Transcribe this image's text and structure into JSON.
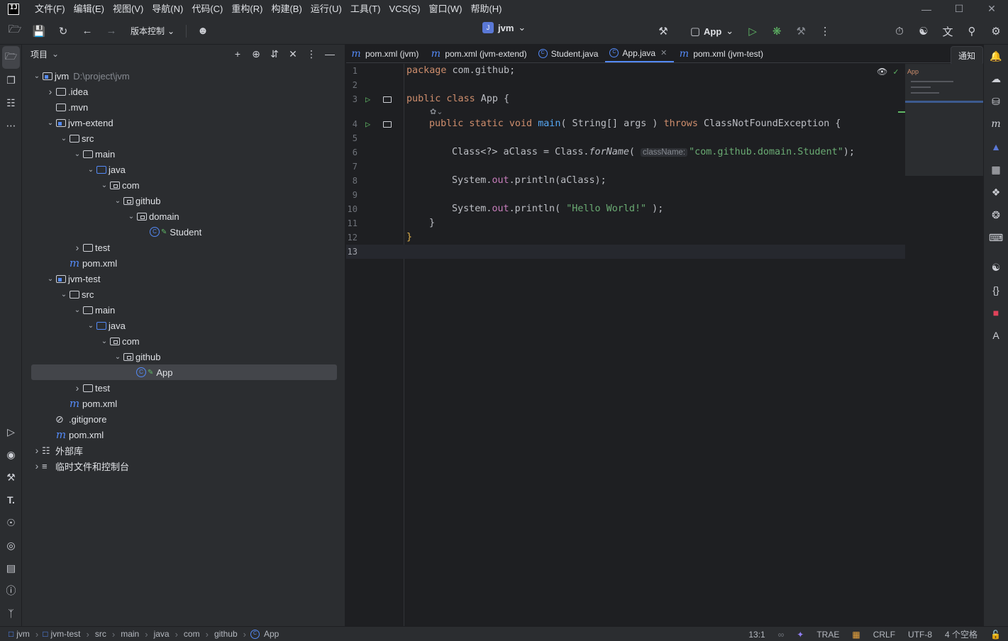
{
  "menu": [
    "文件(F)",
    "编辑(E)",
    "视图(V)",
    "导航(N)",
    "代码(C)",
    "重构(R)",
    "构建(B)",
    "运行(U)",
    "工具(T)",
    "VCS(S)",
    "窗口(W)",
    "帮助(H)"
  ],
  "toolbar": {
    "vcs_label": "版本控制",
    "project_badge": "J",
    "project_name": "jvm",
    "run_config": "App"
  },
  "project_panel": {
    "title": "项目"
  },
  "tree": [
    {
      "depth": 0,
      "chev": "v",
      "icon": "module",
      "label": "jvm",
      "hint": "D:\\project\\jvm"
    },
    {
      "depth": 1,
      "chev": ">",
      "icon": "folder",
      "label": ".idea"
    },
    {
      "depth": 1,
      "chev": "",
      "icon": "folder",
      "label": ".mvn"
    },
    {
      "depth": 1,
      "chev": "v",
      "icon": "module",
      "label": "jvm-extend"
    },
    {
      "depth": 2,
      "chev": "v",
      "icon": "folder",
      "label": "src"
    },
    {
      "depth": 3,
      "chev": "v",
      "icon": "folder",
      "label": "main"
    },
    {
      "depth": 4,
      "chev": "v",
      "icon": "folder-blue",
      "label": "java"
    },
    {
      "depth": 5,
      "chev": "v",
      "icon": "package",
      "label": "com"
    },
    {
      "depth": 6,
      "chev": "v",
      "icon": "package",
      "label": "github"
    },
    {
      "depth": 7,
      "chev": "v",
      "icon": "package",
      "label": "domain"
    },
    {
      "depth": 8,
      "chev": "",
      "icon": "class",
      "label": "Student"
    },
    {
      "depth": 3,
      "chev": ">",
      "icon": "folder",
      "label": "test"
    },
    {
      "depth": 2,
      "chev": "",
      "icon": "maven",
      "label": "pom.xml"
    },
    {
      "depth": 1,
      "chev": "v",
      "icon": "module",
      "label": "jvm-test"
    },
    {
      "depth": 2,
      "chev": "v",
      "icon": "folder",
      "label": "src"
    },
    {
      "depth": 3,
      "chev": "v",
      "icon": "folder",
      "label": "main"
    },
    {
      "depth": 4,
      "chev": "v",
      "icon": "folder-blue",
      "label": "java"
    },
    {
      "depth": 5,
      "chev": "v",
      "icon": "package",
      "label": "com"
    },
    {
      "depth": 6,
      "chev": "v",
      "icon": "package",
      "label": "github"
    },
    {
      "depth": 7,
      "chev": "",
      "icon": "class-run",
      "label": "App",
      "selected": true
    },
    {
      "depth": 3,
      "chev": ">",
      "icon": "folder",
      "label": "test"
    },
    {
      "depth": 2,
      "chev": "",
      "icon": "maven",
      "label": "pom.xml"
    },
    {
      "depth": 1,
      "chev": "",
      "icon": "ignore",
      "label": ".gitignore"
    },
    {
      "depth": 1,
      "chev": "",
      "icon": "maven",
      "label": "pom.xml"
    },
    {
      "depth": 0,
      "chev": ">",
      "icon": "library",
      "label": "外部库"
    },
    {
      "depth": 0,
      "chev": ">",
      "icon": "scratch",
      "label": "临时文件和控制台"
    }
  ],
  "tabs": [
    {
      "icon": "maven",
      "label": "pom.xml (jvm)"
    },
    {
      "icon": "maven",
      "label": "pom.xml (jvm-extend)"
    },
    {
      "icon": "class",
      "label": "Student.java"
    },
    {
      "icon": "class-run",
      "label": "App.java",
      "active": true
    },
    {
      "icon": "maven",
      "label": "pom.xml (jvm-test)"
    }
  ],
  "notification_label": "通知",
  "minimap_label": "App",
  "code": {
    "l1_kw": "package",
    "l1_rest": " com.github;",
    "l3_kw": "public class",
    "l3_rest": " App {",
    "l4_kw1": "public static void",
    "l4_fn": "main",
    "l4_mid": "( String[] args ) ",
    "l4_kw2": "throws",
    "l4_end": " ClassNotFoundException {",
    "l6_a": "Class<?> aClass = Class.",
    "l6_fn": "forName",
    "l6_p": "(",
    "l6_hint": "className:",
    "l6_str": "\"com.github.domain.Student\"",
    "l6_end": ");",
    "l8_a": "System.",
    "l8_f": "out",
    "l8_b": ".println(aClass);",
    "l10_a": "System.",
    "l10_f": "out",
    "l10_b": ".println( ",
    "l10_str": "\"Hello World!\"",
    "l10_end": " );",
    "l11": "}",
    "l12": "}"
  },
  "line_numbers": [
    "1",
    "2",
    "3",
    "4",
    "5",
    "6",
    "7",
    "8",
    "9",
    "10",
    "11",
    "12",
    "13"
  ],
  "breadcrumbs": [
    "jvm",
    "jvm-test",
    "src",
    "main",
    "java",
    "com",
    "github",
    "App"
  ],
  "status": {
    "position": "13:1",
    "trae": "TRAE",
    "line_sep": "CRLF",
    "encoding": "UTF-8",
    "indent": "4 个空格"
  }
}
